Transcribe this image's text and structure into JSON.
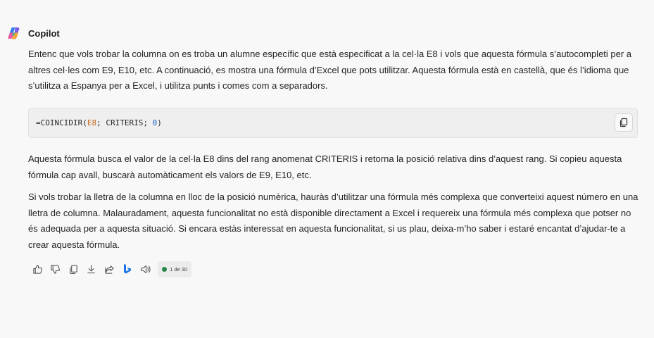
{
  "message": {
    "sender": "Copilot",
    "intro": "Entenc que vols trobar la columna on es troba un alumne específic que està especificat a la cel·la E8 i vols que aquesta fórmula s’autocompleti per a altres cel·les com E9, E10, etc. A continuació, es mostra una fórmula d’Excel que pots utilitzar. Aquesta fórmula està en castellà, que és l’idioma que s’utilitza a Espanya per a Excel, i utilitza punts i comes com a separadors.",
    "code": {
      "fn": "=COINCIDIR(",
      "ref": "E8",
      "mid": "; CRITERIS; ",
      "num": "0",
      "end": ")"
    },
    "explanation": "Aquesta fórmula busca el valor de la cel·la E8 dins del rang anomenat CRITERIS i retorna la posició relativa dins d’aquest rang. Si copieu aquesta fórmula cap avall, buscarà automàticament els valors de E9, E10, etc.",
    "followup": "Si vols trobar la lletra de la columna en lloc de la posició numèrica, hauràs d’utilitzar una fórmula més complexa que converteixi aquest número en una lletra de columna. Malauradament, aquesta funcionalitat no està disponible directament a Excel i requereix una fórmula més complexa que potser no és adequada per a aquesta situació. Si encara estàs interessat en aquesta funcionalitat, si us plau, deixa-m’ho saber i estaré encantat d’ajudar-te a crear aquesta fórmula."
  },
  "actions": {
    "icons": [
      "thumbs-up-icon",
      "thumbs-down-icon",
      "copy-icon",
      "download-icon",
      "share-icon",
      "bing-icon",
      "speaker-icon"
    ],
    "counter": "1 de 30"
  },
  "colors": {
    "background": "#f8f8f8",
    "code_ref": "#c5651a",
    "code_number": "#1960c8",
    "bing_blue": "#1a73e8",
    "status_dot": "#2b8a4b"
  }
}
